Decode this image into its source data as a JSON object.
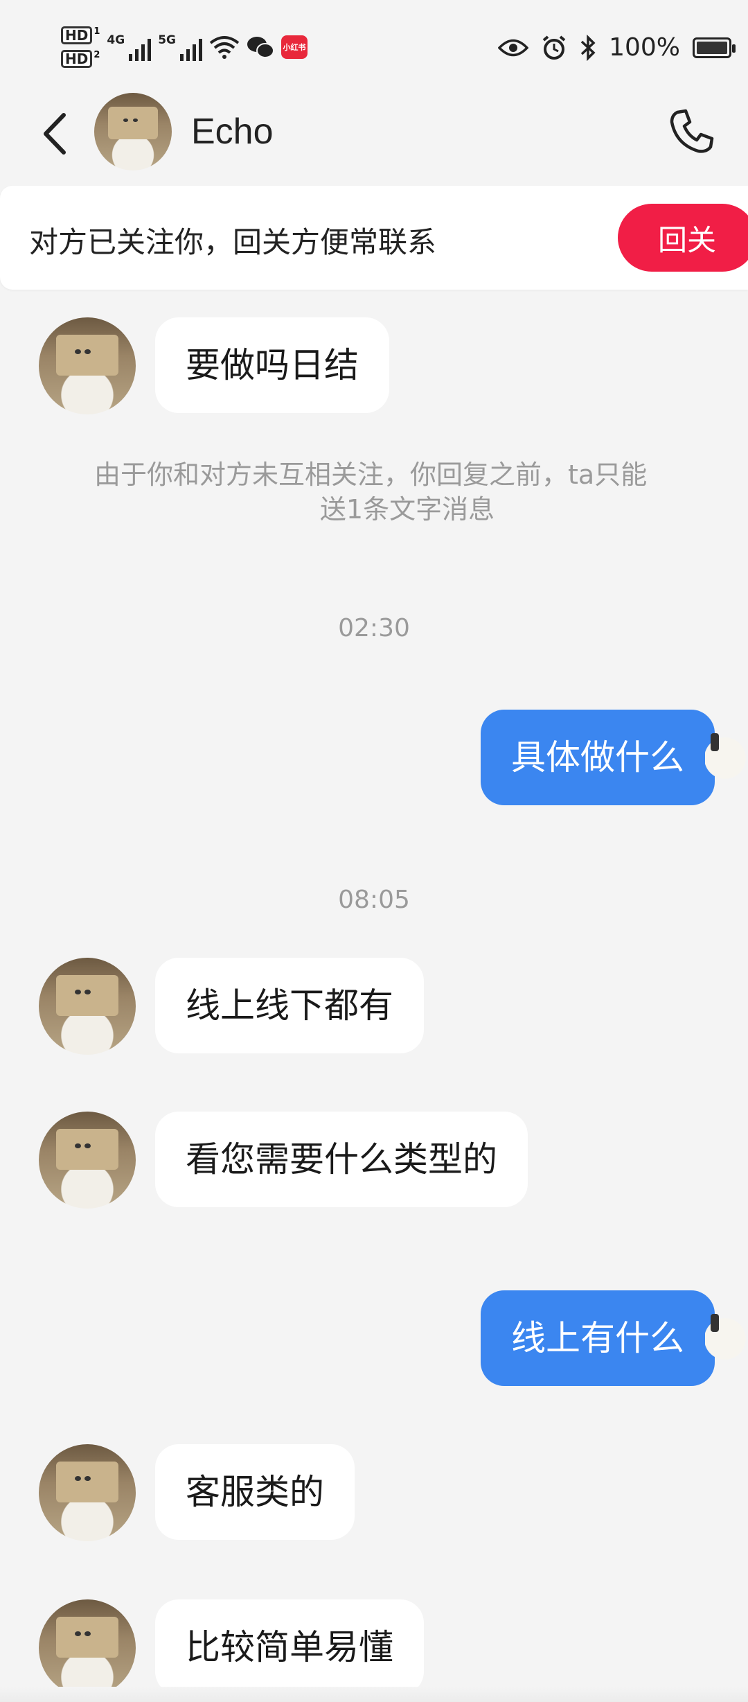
{
  "status_bar": {
    "hd1": "HD",
    "hd1_sub": "1",
    "hd2": "HD",
    "hd2_sub": "2",
    "net1": "4G",
    "net2": "5G",
    "app_badge": "小红书",
    "battery": "100%"
  },
  "header": {
    "contact_name": "Echo"
  },
  "banner": {
    "text": "对方已关注你，回关方便常联系",
    "button": "回关"
  },
  "messages": [
    {
      "side": "in",
      "text": "要做吗日结"
    },
    {
      "side": "in",
      "text": "线上线下都有"
    },
    {
      "side": "in",
      "text": "看您需要什么类型的"
    },
    {
      "side": "in",
      "text": "客服类的"
    },
    {
      "side": "in",
      "text": "比较简单易懂"
    }
  ],
  "outgoing": [
    {
      "text": "具体做什么"
    },
    {
      "text": "线上有什么"
    }
  ],
  "system_notice": {
    "line1": "由于你和对方未互相关注，你回复之前，ta只能",
    "line2": "送1条文字消息"
  },
  "timestamps": [
    "02:30",
    "08:05"
  ],
  "colors": {
    "accent_blue": "#3b86f0",
    "follow_red": "#f11e46",
    "background": "#f4f4f4"
  },
  "icons": [
    "back-arrow-icon",
    "phone-icon",
    "eye-icon",
    "alarm-icon",
    "bluetooth-icon",
    "wifi-icon",
    "wechat-icon",
    "battery-icon"
  ]
}
